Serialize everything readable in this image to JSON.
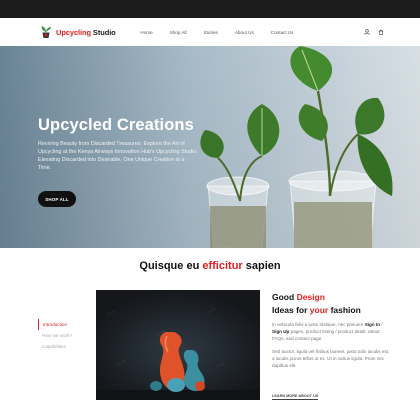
{
  "brand": {
    "name_part1": "Upcycling",
    "name_part2": " Studio",
    "accent_color": "#e02020"
  },
  "nav": {
    "items": [
      {
        "label": "Home"
      },
      {
        "label": "Shop All"
      },
      {
        "label": "Stories"
      },
      {
        "label": "About Us"
      },
      {
        "label": "Contact Us"
      }
    ],
    "icons": [
      "user-icon",
      "cart-icon"
    ]
  },
  "hero": {
    "title": "Upcycled Creations",
    "description": "Reviving Beauty from Discarded Treasures: Explore the Art of Upcycling at the Kenya Airways Innovation Hub's Upcycling Studio. Elevating Discarded into Desirable, One Unique Creation at a Time.",
    "cta_label": "SHOP ALL"
  },
  "section": {
    "title_part1": "Quisque eu ",
    "title_accent": "efficitur",
    "title_part2": " sapien"
  },
  "tabs": [
    {
      "label": "Introduction",
      "active": true
    },
    {
      "label": "How we work?",
      "active": false
    },
    {
      "label": "Capabilities",
      "active": false
    }
  ],
  "feature": {
    "heading_a1": "Good ",
    "heading_a2": "Design",
    "heading_b1": "Ideas for ",
    "heading_b2": "your",
    "heading_b3": " fashion",
    "p1_a": "In vehicula felis a justo tristique, nec posuere ",
    "p1_b": "Sign In",
    "p1_c": " / ",
    "p1_d": "Sign Up",
    "p1_e": " pages, product listing / product detail, about, FAQs, and contact page.",
    "p2": "Sed auctor, ligula vel finibus laoreet, justo odio iaculis est, a iaculis purus tellus ut ex. Ut in varius ligula. Proin nec dapibus elit.",
    "link_label": "LEARN MORE ABOUT US"
  }
}
